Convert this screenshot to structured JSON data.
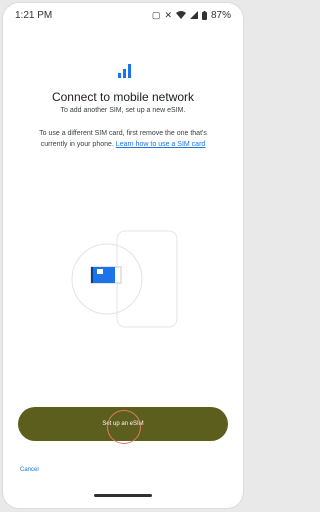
{
  "status_bar": {
    "time": "1:21 PM",
    "battery_percent": "87%",
    "icons": [
      "nfc-icon",
      "mute-icon",
      "wifi-icon",
      "cellular-icon",
      "battery-icon"
    ]
  },
  "header": {
    "title": "Connect to mobile network",
    "subtitle": "To add another SIM, set up a new eSIM."
  },
  "body": {
    "description": "To use a different SIM card, first remove the one that's currently in your phone.",
    "link_text": "Learn how to use a SIM card"
  },
  "actions": {
    "primary_label": "Set up an eSIM",
    "cancel_label": "Cancel"
  },
  "colors": {
    "primary_button": "#5b5e1c",
    "link": "#1a73e8",
    "accent": "#1a73e8",
    "tap_indicator": "#e07a5f"
  }
}
